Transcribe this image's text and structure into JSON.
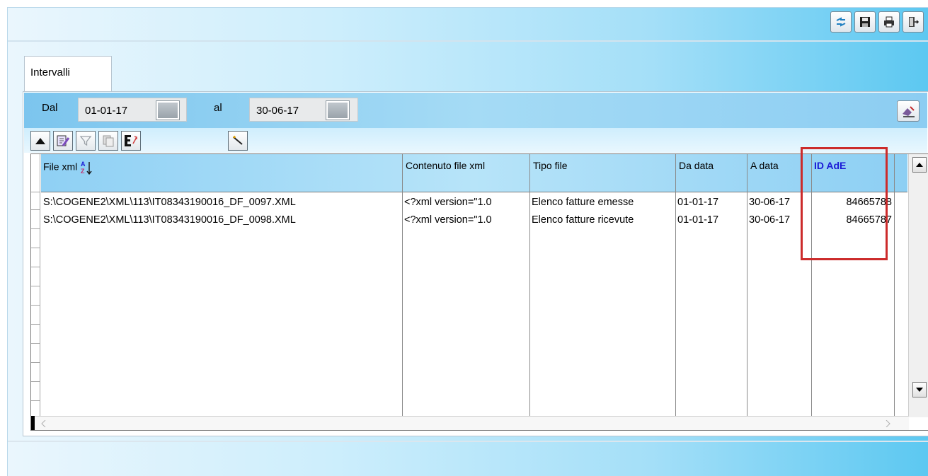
{
  "tab": {
    "label": "Intervalli"
  },
  "interval": {
    "from_label": "Dal",
    "from_value": "01-01-17",
    "to_label": "al",
    "to_value": "30-06-17"
  },
  "table": {
    "columns": [
      "File xml",
      "Contenuto file xml",
      "Tipo file",
      "Da data",
      "A data",
      "ID AdE"
    ],
    "rows": [
      {
        "file": "S:\\COGENE2\\XML\\113\\IT08343190016_DF_0097.XML",
        "content": "<?xml version=\"1.0",
        "type": "Elenco fatture emesse",
        "from": "01-01-17",
        "to": "30-06-17",
        "id": "84665788"
      },
      {
        "file": "S:\\COGENE2\\XML\\113\\IT08343190016_DF_0098.XML",
        "content": "<?xml version=\"1.0",
        "type": "Elenco fatture ricevute",
        "from": "01-01-17",
        "to": "30-06-17",
        "id": "84665787"
      }
    ]
  },
  "icons": {
    "top_toolbar": [
      "refresh-icon",
      "save-icon",
      "print-icon",
      "exit-icon"
    ],
    "grid_toolbar": [
      "collapse-up-icon",
      "edit-record-icon",
      "filter-icon",
      "copy-icon",
      "export-excel-icon",
      "wand-icon"
    ]
  },
  "colors": {
    "highlight": "#cc2b2b",
    "header_text_accent": "#1b1bd6"
  }
}
